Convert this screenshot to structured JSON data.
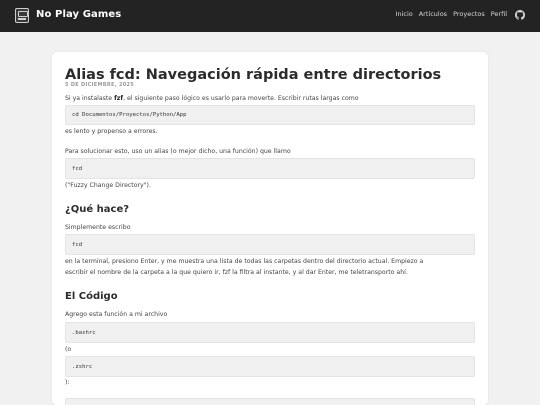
{
  "header": {
    "brand": "No Play Games",
    "nav": [
      "Inicio",
      "Artículos",
      "Proyectos",
      "Perfil"
    ]
  },
  "article": {
    "title": "Alias fcd: Navegación rápida entre directorios",
    "date": "5 DE DICIEMBRE, 2025",
    "p1_before": "Si ya instalaste ",
    "p1_bold": "fzf",
    "p1_after": ", el siguiente paso lógico es usarlo para moverte. Escribir rutas largas como",
    "code1": "cd Documentos/Proyectos/Python/App",
    "p2": "es lento y propenso a errores.",
    "p3": "Para solucionar esto, uso un alias (o mejor dicho, una función) que llamo",
    "code2": "fcd",
    "p4": "(\"Fuzzy Change Directory\").",
    "h2_1": "¿Qué hace?",
    "p5": "Simplemente escribo",
    "code3": "fcd",
    "p6a": "en la terminal, presiono Enter, y me muestra una lista de todas las carpetas dentro del directorio actual. Empiezo a",
    "p6b": "escribir el nombre de la carpeta a la que quiero ir, fzf la filtra al instante, y al dar Enter, me teletransporto ahí.",
    "h2_2": "El Código",
    "p7": "Agrego esta función a mi archivo",
    "code4": ".bashrc",
    "p8": "(o",
    "code5": ".zshrc",
    "p9": "):"
  }
}
